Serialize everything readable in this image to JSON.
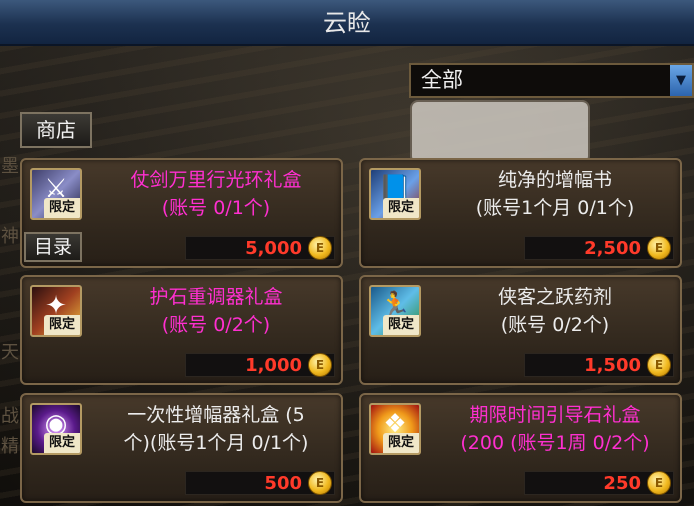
{
  "window": {
    "title": "云睑"
  },
  "filter": {
    "selected": "全部",
    "arrow": "▼"
  },
  "tabs": {
    "shop": "商店",
    "catalog": "目录"
  },
  "side_chars": [
    "墨",
    "神",
    "天",
    "战",
    "精"
  ],
  "colors": {
    "price": "#ff3a2a",
    "title_special": "#ff2fd0",
    "title_normal": "#ececec"
  },
  "items": [
    {
      "name": "仗剑万里行光环礼盒\n(账号 0/1个)",
      "badge": "限定",
      "price": "5,000",
      "title_style": "pink",
      "icon": "sword-box-icon",
      "icon_bg": "linear-gradient(135deg,#3f3f6a,#8a8dc7 50%,#202040)",
      "glyph": "⚔"
    },
    {
      "name": "纯净的增幅书\n(账号1个月 0/1个)",
      "badge": "限定",
      "price": "2,500",
      "title_style": "white",
      "icon": "amplify-book-icon",
      "icon_bg": "linear-gradient(135deg,#1f3f78,#6aa0e8 55%,#8c2a24)",
      "glyph": "📘"
    },
    {
      "name": "护石重调器礼盒\n(账号 0/2个)",
      "badge": "限定",
      "price": "1,000",
      "title_style": "pink",
      "icon": "talisman-box-icon",
      "icon_bg": "linear-gradient(135deg,#2c1010,#a04020 50%,#f0c040)",
      "glyph": "✦"
    },
    {
      "name": "侠客之跃药剂\n(账号 0/2个)",
      "badge": "限定",
      "price": "1,500",
      "title_style": "white",
      "icon": "potion-jump-icon",
      "icon_bg": "linear-gradient(135deg,#1a5a8a,#5fbde8 50%,#2a8a3a)",
      "glyph": "🏃"
    },
    {
      "name": "一次性增幅器礼盒 (5\n个)(账号1个月 0/1个)",
      "badge": "限定",
      "price": "500",
      "title_style": "white",
      "icon": "amplifier-box-icon",
      "icon_bg": "radial-gradient(circle,#e0a0ff,#5a1a8a 55%,#1a0a2a)",
      "glyph": "◉"
    },
    {
      "name": "期限时间引导石礼盒\n(200 (账号1周 0/2个)",
      "badge": "限定",
      "price": "250",
      "title_style": "pink",
      "icon": "guide-stone-box-icon",
      "icon_bg": "radial-gradient(circle,#fff08a,#f09a1a 50%,#a01010)",
      "glyph": "❖"
    }
  ],
  "coin_glyph": "E"
}
